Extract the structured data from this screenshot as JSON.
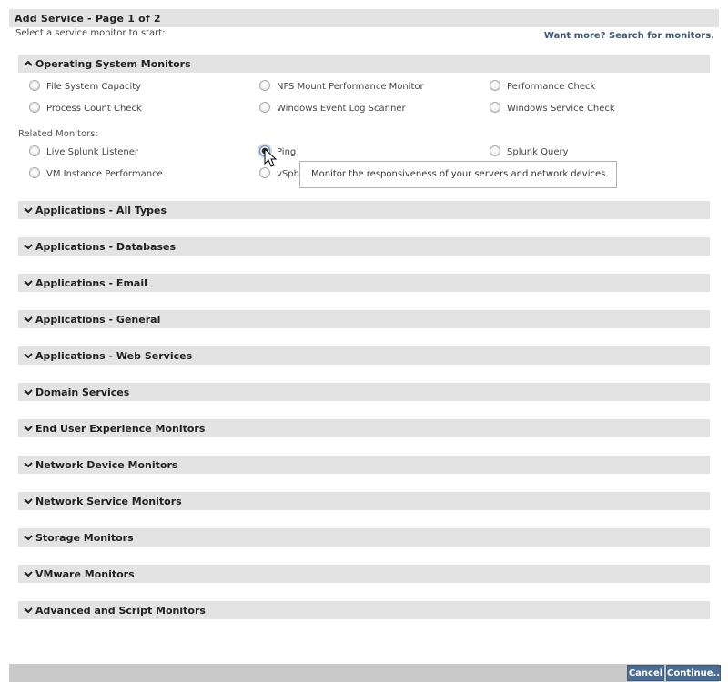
{
  "header": {
    "title": "Add Service - Page 1 of 2",
    "subtitle": "Select a service monitor to start:",
    "more_link": "Want more? Search for monitors."
  },
  "expanded_section": {
    "title": "Operating System Monitors",
    "options": [
      {
        "label": "File System Capacity",
        "selected": false
      },
      {
        "label": "NFS Mount Performance Monitor",
        "selected": false
      },
      {
        "label": "Performance Check",
        "selected": false
      },
      {
        "label": "Process Count Check",
        "selected": false
      },
      {
        "label": "Windows Event Log Scanner",
        "selected": false
      },
      {
        "label": "Windows Service Check",
        "selected": false
      }
    ],
    "related_label": "Related Monitors:",
    "related_options": [
      {
        "label": "Live Splunk Listener",
        "selected": false
      },
      {
        "label": "Ping",
        "selected": true
      },
      {
        "label": "Splunk Query",
        "selected": false
      },
      {
        "label": "VM Instance Performance",
        "selected": false
      },
      {
        "label": "vSph",
        "selected": false
      }
    ]
  },
  "tooltip": "Monitor the responsiveness of your servers and network devices.",
  "sections": [
    "Applications - All Types",
    "Applications - Databases",
    "Applications - Email",
    "Applications - General",
    "Applications - Web Services",
    "Domain Services",
    "End User Experience Monitors",
    "Network Device Monitors",
    "Network Service Monitors",
    "Storage Monitors",
    "VMware Monitors",
    "Advanced and Script Monitors"
  ],
  "footer": {
    "cancel_label": "Cancel",
    "continue_label": "Continue..."
  },
  "colors": {
    "bar_bg": "#e3e3e3",
    "link": "#3c5a7a",
    "button_bg": "#4a6d94"
  }
}
